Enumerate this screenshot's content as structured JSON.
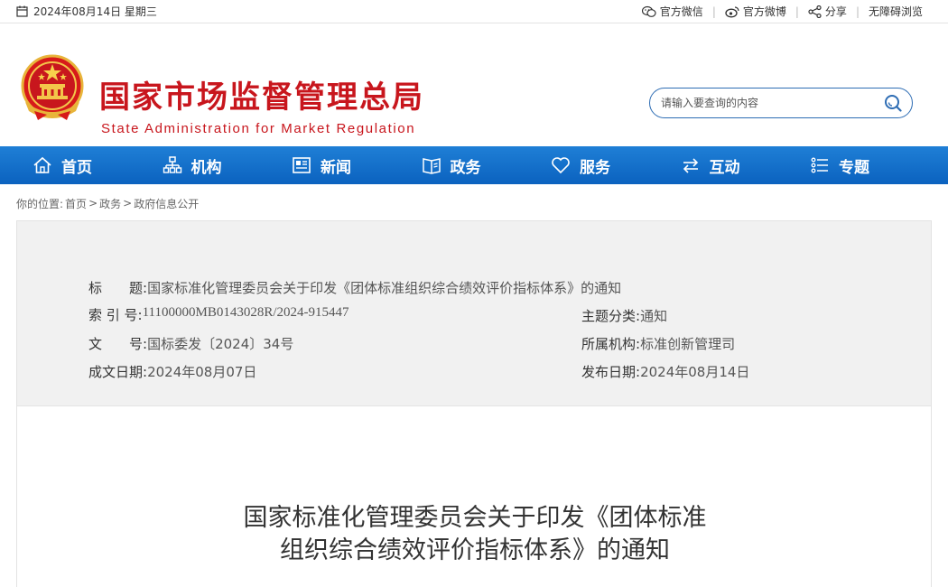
{
  "topbar": {
    "date": "2024年08月14日 星期三",
    "links": [
      {
        "icon": "wechat-icon",
        "label": "官方微信"
      },
      {
        "icon": "weibo-icon",
        "label": "官方微博"
      },
      {
        "icon": "share-icon",
        "label": "分享"
      },
      {
        "icon": "",
        "label": "无障碍浏览"
      }
    ]
  },
  "header": {
    "title_cn": "国家市场监督管理总局",
    "title_en": "State Administration for Market Regulation",
    "search_placeholder": "请输入要查询的内容"
  },
  "nav": {
    "items": [
      {
        "icon": "home-icon",
        "label": "首页"
      },
      {
        "icon": "org-chart-icon",
        "label": "机构"
      },
      {
        "icon": "news-icon",
        "label": "新闻"
      },
      {
        "icon": "book-icon",
        "label": "政务"
      },
      {
        "icon": "heart-icon",
        "label": "服务"
      },
      {
        "icon": "exchange-icon",
        "label": "互动"
      },
      {
        "icon": "list-icon",
        "label": "专题"
      }
    ]
  },
  "breadcrumb": {
    "prefix": "你的位置:",
    "items": [
      "首页",
      "政务",
      "政府信息公开"
    ],
    "separator": ">"
  },
  "meta": {
    "title_label": "标　　题:",
    "title_value": "国家标准化管理委员会关于印发《团体标准组织综合绩效评价指标体系》的通知",
    "index_label": "索 引 号:",
    "index_value": "11100000MB0143028R/2024-915447",
    "topic_label": "主题分类:",
    "topic_value": "通知",
    "doc_label": "文　　号:",
    "doc_value": "国标委发〔2024〕34号",
    "org_label": "所属机构:",
    "org_value": "标准创新管理司",
    "written_label": "成文日期:",
    "written_value": "2024年08月07日",
    "published_label": "发布日期:",
    "published_value": "2024年08月14日"
  },
  "document": {
    "title_line1": "国家标准化管理委员会关于印发《团体标准",
    "title_line2": "组织综合绩效评价指标体系》的通知"
  },
  "colors": {
    "brand_red": "#c8161d",
    "nav_blue": "#1270cc",
    "search_border": "#2e6db4"
  }
}
